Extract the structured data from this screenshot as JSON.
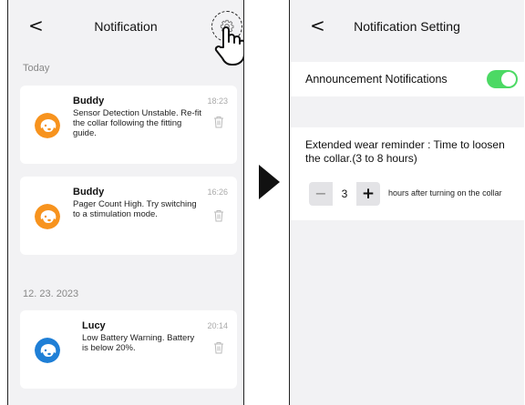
{
  "left_screen": {
    "back_icon": "chevron-left-icon",
    "title": "Notification",
    "settings_icon": "gear-icon",
    "pointer_icon": "hand-pointer-icon",
    "sections": [
      {
        "label": "Today",
        "items": [
          {
            "name": "Buddy",
            "time": "18:23",
            "message": "Sensor Detection Unstable. Re-fit the collar following the fitting guide.",
            "avatar_color": "#f7931e",
            "avatar_icon": "dog-icon"
          },
          {
            "name": "Buddy",
            "time": "16:26",
            "message": "Pager Count High. Try switching to a stimulation mode.",
            "avatar_color": "#f7931e",
            "avatar_icon": "dog-icon"
          }
        ]
      },
      {
        "label": "12. 23. 2023",
        "items": [
          {
            "name": "Lucy",
            "time": "20:14",
            "message": "Low Battery Warning. Battery is below 20%.",
            "avatar_color": "#1f7fd6",
            "avatar_icon": "dog-icon"
          }
        ]
      }
    ]
  },
  "transition_icon": "arrow-right-icon",
  "right_screen": {
    "back_icon": "chevron-left-icon",
    "title": "Notification Setting",
    "announcement": {
      "label": "Announcement Notifications",
      "enabled": true,
      "toggle_color": "#4cd964"
    },
    "extended_wear": {
      "description": "Extended wear reminder : Time to loosen the collar.(3 to 8 hours)",
      "minus_label": "−",
      "value": "3",
      "plus_label": "+",
      "suffix": "hours after turning on the collar"
    }
  }
}
